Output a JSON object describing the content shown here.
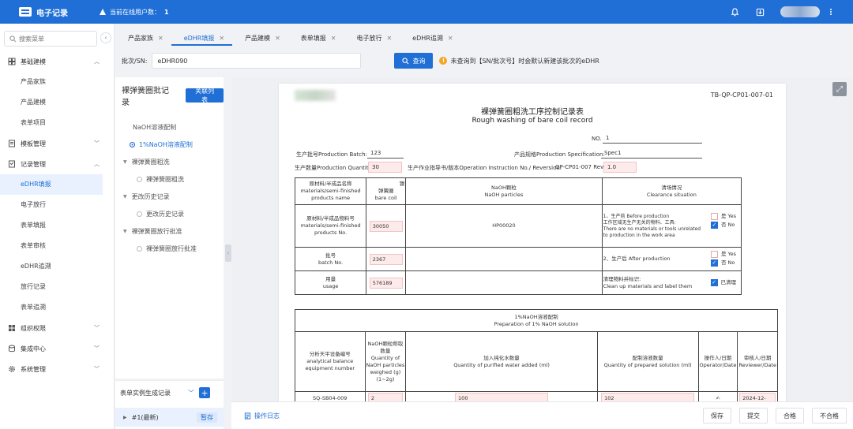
{
  "app": {
    "title": "电子记录",
    "online_label": "当前在线用户数：",
    "online_count": "1"
  },
  "sidebar": {
    "search_placeholder": "搜索菜单",
    "groups": [
      {
        "label": "基础建模",
        "items": [
          "产品家族",
          "产品建模",
          "表单项目"
        ]
      },
      {
        "label": "模板管理",
        "items": []
      },
      {
        "label": "记录管理",
        "items": [
          "eDHR填报",
          "电子放行",
          "表单填报",
          "表单审核",
          "eDHR追溯",
          "放行记录",
          "表单追溯"
        ]
      },
      {
        "label": "组织权限",
        "items": []
      },
      {
        "label": "集成中心",
        "items": []
      },
      {
        "label": "系统管理",
        "items": []
      }
    ],
    "active_item": "eDHR填报"
  },
  "tabs": [
    {
      "label": "产品家族",
      "active": false
    },
    {
      "label": "eDHR填报",
      "active": true
    },
    {
      "label": "产品建模",
      "active": false
    },
    {
      "label": "表单填报",
      "active": false
    },
    {
      "label": "电子放行",
      "active": false
    },
    {
      "label": "eDHR追溯",
      "active": false
    }
  ],
  "query": {
    "label": "批次/SN:",
    "value": "eDHR090",
    "button": "查询",
    "tip": "未查询到【SN/批次号】时会默认新建该批次的eDHR"
  },
  "tree": {
    "title": "裸弹簧圈批记录",
    "link_button": "关联列表",
    "nodes": [
      {
        "label": "NaOH溶液配制",
        "level": 0,
        "type": "plain"
      },
      {
        "label": "1%NaOH溶液配制",
        "level": 1,
        "type": "dot-active"
      },
      {
        "label": "裸弹簧圈粗洗",
        "level": 0,
        "type": "caret"
      },
      {
        "label": "裸弹簧圈粗洗",
        "level": 1,
        "type": "dot"
      },
      {
        "label": "更改历史记录",
        "level": 0,
        "type": "caret"
      },
      {
        "label": "更改历史记录",
        "level": 1,
        "type": "dot"
      },
      {
        "label": "裸弹簧圈放行批准",
        "level": 0,
        "type": "caret"
      },
      {
        "label": "裸弹簧圈放行批准",
        "level": 1,
        "type": "dot"
      }
    ]
  },
  "instances": {
    "title": "表单实例生成记录",
    "row_label": "#1(最新)",
    "row_badge": "暂存"
  },
  "document": {
    "code": "TB-QP-CP01-007-01",
    "title_cn": "裸弹簧圈粗洗工序控制记录表",
    "title_en": "Rough washing of bare coil record",
    "no_label": "NO.",
    "no_value": "1",
    "batch_label": "生产批号Production Batch:",
    "batch_value": "123",
    "spec_label": "产品规格Production Specification:",
    "spec_value": "Spec1",
    "qty_label": "生产数量Production Quantity:",
    "qty_value": "30",
    "instr_label": "生产作业指导书/版本Operation Instruction No./ Reversion:",
    "instr_value": "QP-CP01-007 Rev.",
    "rev_value": "1.0",
    "table1": {
      "h_material_cn": "原材料/半成品名称",
      "h_material_en": "materials/semi-finished products name",
      "h_material_mark": "镍",
      "h_coil_cn": "弹簧圈",
      "h_coil_en": "bare coil",
      "h_naoh_cn": "NaOH颗粒",
      "h_naoh_en": "NaOH particles",
      "h_clear_cn": "清场情况",
      "h_clear_en": "Clearance situation",
      "r1_label_cn": "原材料/半成品物料号",
      "r1_label_en": "materials/semi-finished products No.",
      "r1_coil": "30050",
      "r1_naoh": "HP00020",
      "r1_clear_1": "1、生产前 Before production",
      "r1_clear_2": "工作区域无生产无关的物料、工具:",
      "r1_clear_3": "There are no materials or tools unrelated to production in the work area",
      "yes": "是 Yes",
      "no": "否 No",
      "r2_label_cn": "批号",
      "r2_label_en": "batch No.",
      "r2_coil": "2367",
      "r2_clear": "2、生产后 After production",
      "r3_label_cn": "用量",
      "r3_label_en": "usage",
      "r3_coil": "576189",
      "r3_clear_cn": "清理物料并标识:",
      "r3_clear_en": "Clean up materials and label them",
      "r3_check": "已清理"
    },
    "table2": {
      "title_cn": "1%NaOH溶液配制",
      "title_en": "Preparation of 1% NaOH solution",
      "c1_cn": "分析天平设备编号",
      "c1_en": "analytical balance equipment number",
      "c2_cn": "NaOH颗粒称取数量",
      "c2_en": "Quantity of NaOH particles weighed (g) (1~2g)",
      "c3_cn": "加入纯化水数量",
      "c3_en": "Quantity of purified water added (ml)",
      "c4_cn": "配制溶液数量",
      "c4_en": "Quantity of prepared solution (ml)",
      "c5_cn": "操作人/日期",
      "c5_en": "Operator/Date",
      "c6_cn": "审核人/日期",
      "c6_en": "Reviewer/Date",
      "row_equip": "SQ-SB04-009",
      "row_naoh": "2",
      "row_water": "100",
      "row_sol": "102",
      "row_date": "2024-12-"
    }
  },
  "bottom": {
    "log": "操作日志",
    "save": "保存",
    "submit": "提交",
    "pass": "合格",
    "fail": "不合格"
  },
  "colors": {
    "primary": "#1f6fd6",
    "field_bg": "#fdeaea",
    "warn": "#f5a623"
  }
}
